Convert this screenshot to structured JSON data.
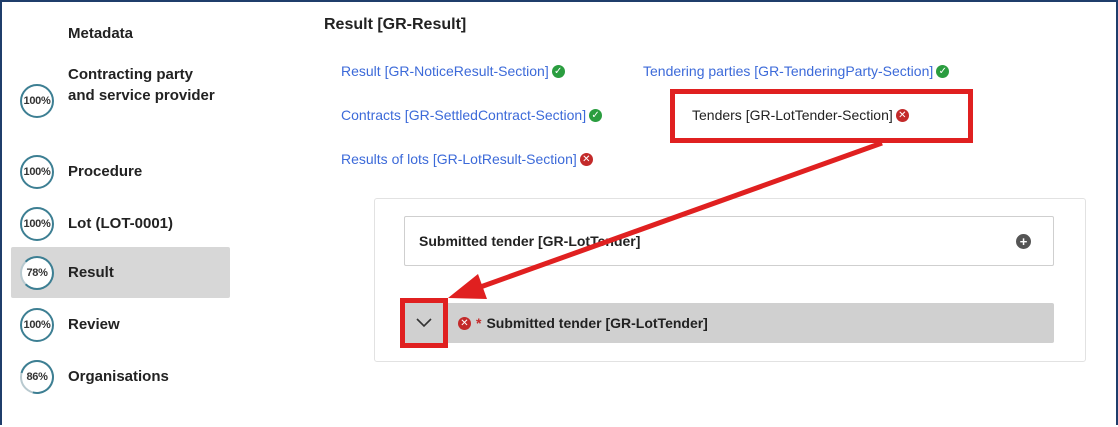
{
  "sidebar": {
    "items": [
      {
        "label": "Metadata",
        "progress": null,
        "active": false
      },
      {
        "label": "Contracting party and service provider",
        "progress": "100%",
        "active": false
      },
      {
        "label": "Procedure",
        "progress": "100%",
        "active": false
      },
      {
        "label": "Lot (LOT-0001)",
        "progress": "100%",
        "active": false
      },
      {
        "label": "Result",
        "progress": "78%",
        "active": true
      },
      {
        "label": "Review",
        "progress": "100%",
        "active": false
      },
      {
        "label": "Organisations",
        "progress": "86%",
        "active": false
      }
    ]
  },
  "main": {
    "title": "Result [GR-Result]",
    "sections": [
      {
        "label": "Result  [GR-NoticeResult-Section]",
        "status": "ok"
      },
      {
        "label": "Tendering parties  [GR-TenderingParty-Section]",
        "status": "ok"
      },
      {
        "label": "Contracts  [GR-SettledContract-Section]",
        "status": "ok"
      },
      {
        "label": "Tenders  [GR-LotTender-Section]",
        "status": "error"
      },
      {
        "label": "Results of lots  [GR-LotResult-Section]",
        "status": "error"
      }
    ],
    "card": {
      "label": "Submitted tender  [GR-LotTender]",
      "add_icon": "plus-circle-icon"
    },
    "collapsible": {
      "label": "Submitted tender  [GR-LotTender]",
      "required_marker": "*",
      "toggle_icon": "chevron-down-icon"
    }
  },
  "colors": {
    "accent_ring": "#3d7f93",
    "link": "#3c6ad9",
    "ok": "#2a9d3f",
    "error": "#c32a2a",
    "annotation": "#e02020"
  }
}
